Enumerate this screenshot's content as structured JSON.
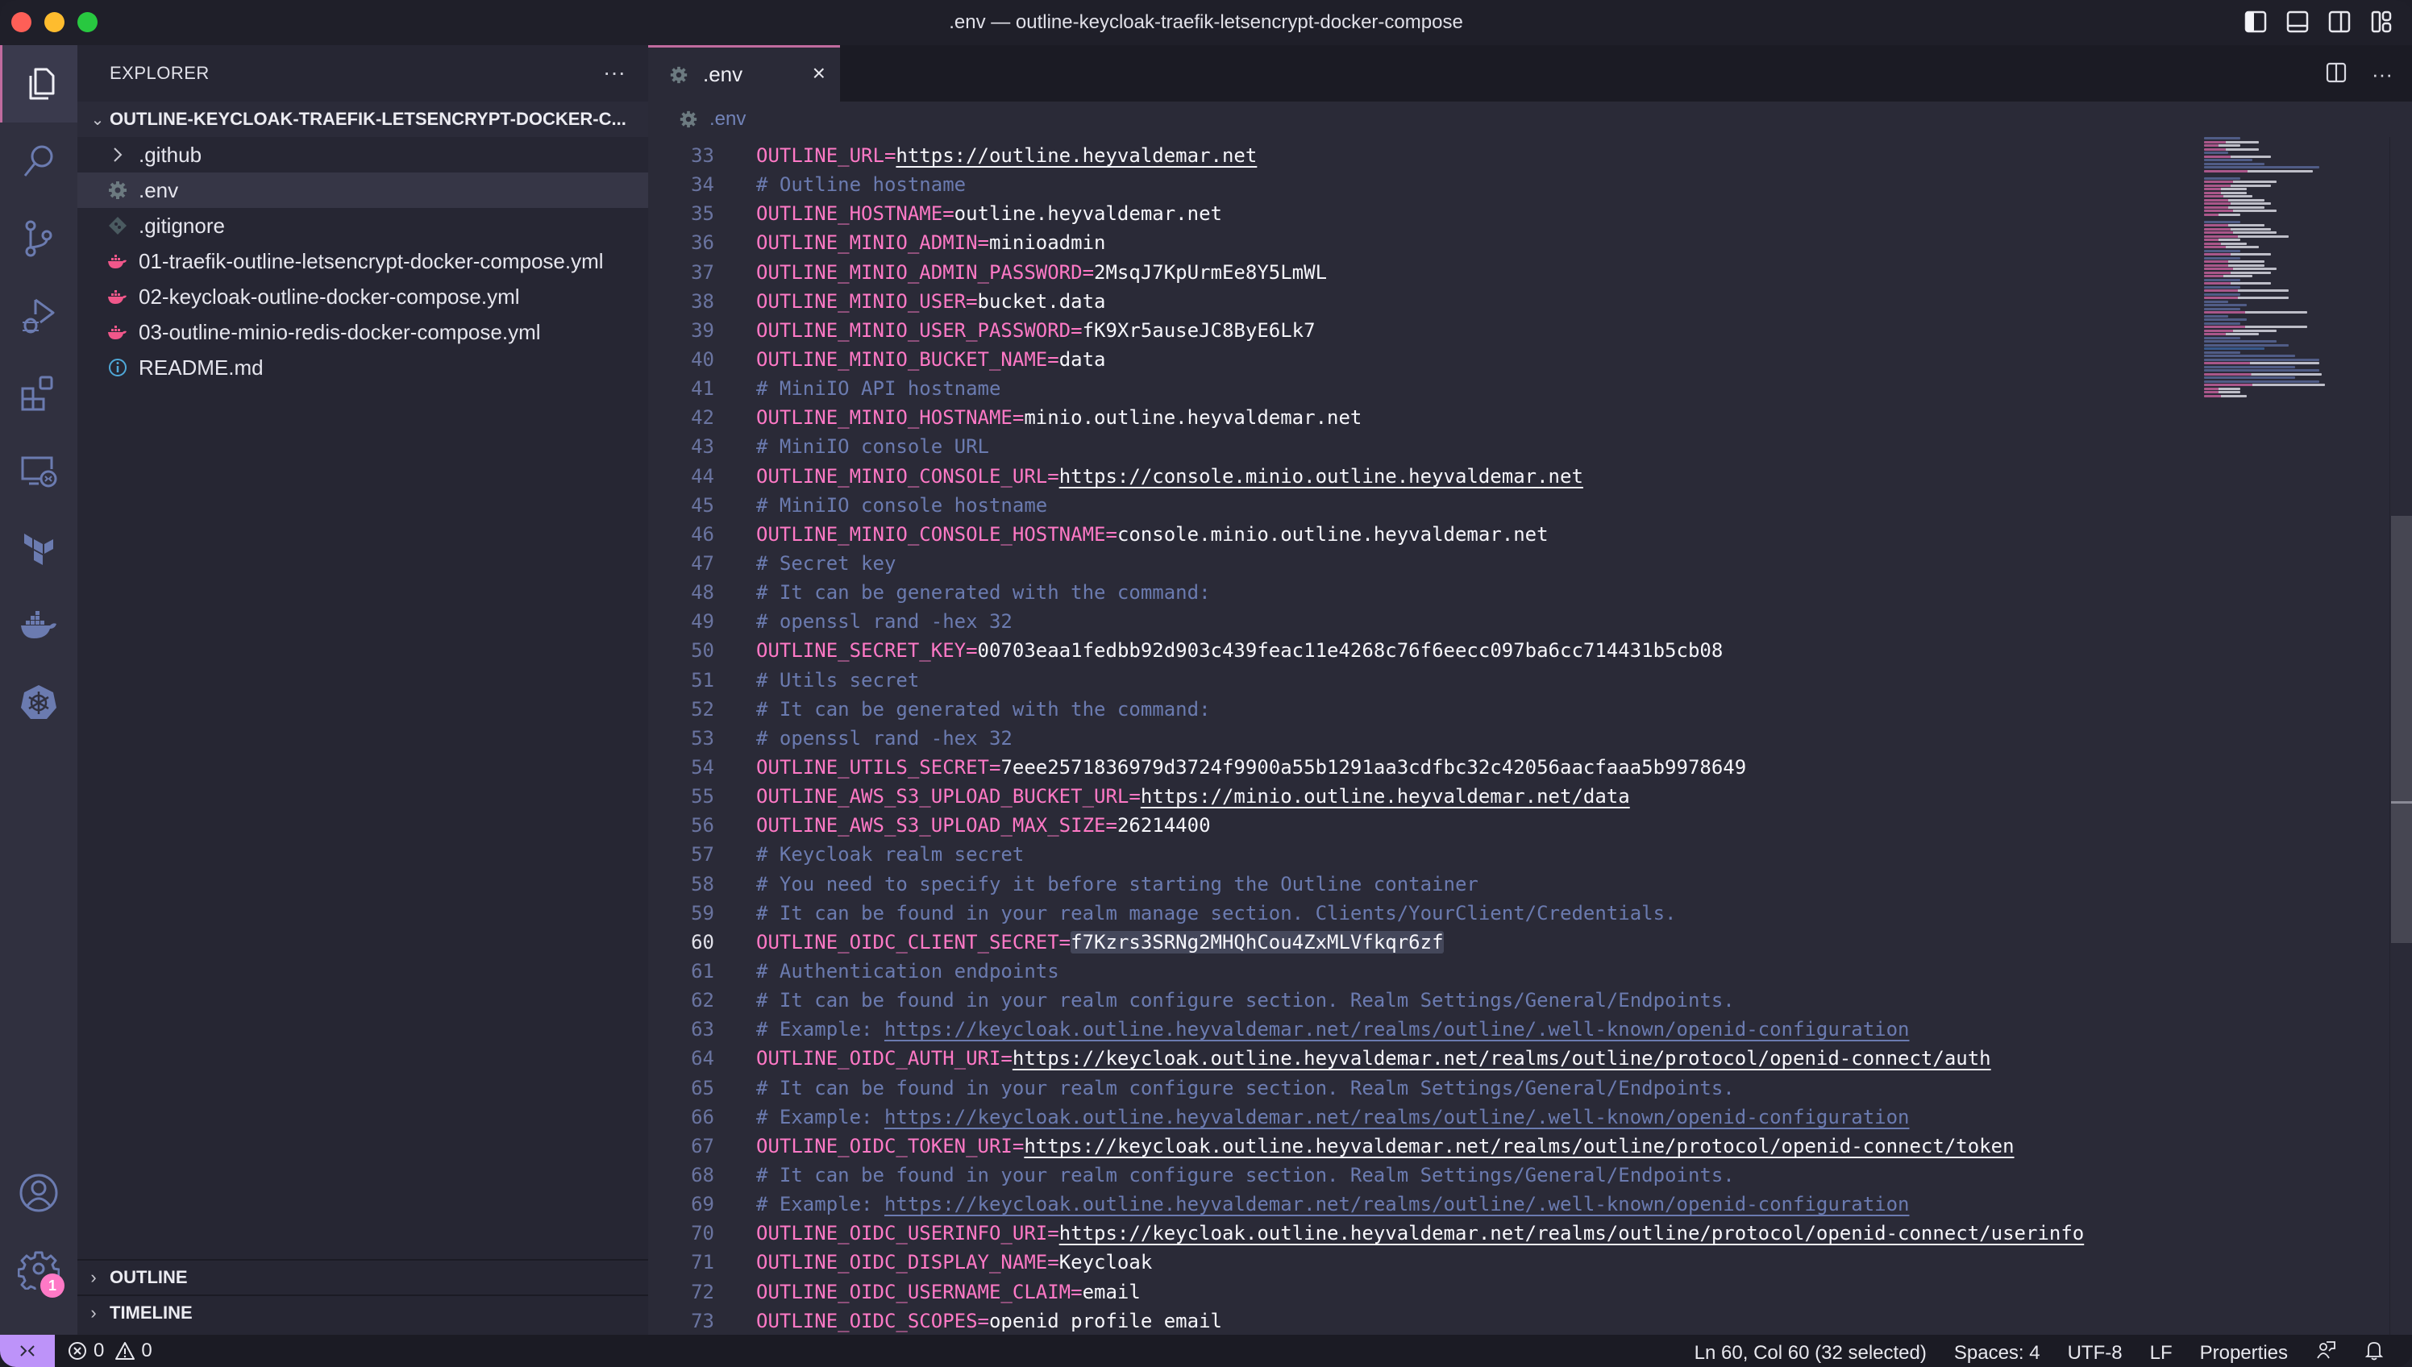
{
  "window": {
    "title": ".env — outline-keycloak-traefik-letsencrypt-docker-compose"
  },
  "activity_bar": {
    "items": [
      {
        "name": "explorer",
        "icon": "files-icon",
        "active": true
      },
      {
        "name": "search",
        "icon": "search-icon"
      },
      {
        "name": "source-control",
        "icon": "source-control-icon"
      },
      {
        "name": "run-debug",
        "icon": "run-debug-icon"
      },
      {
        "name": "extensions",
        "icon": "extensions-icon"
      },
      {
        "name": "remote-explorer",
        "icon": "remote-explorer-icon"
      },
      {
        "name": "terraform",
        "icon": "terraform-icon"
      },
      {
        "name": "docker",
        "icon": "docker-icon"
      },
      {
        "name": "kubernetes",
        "icon": "kubernetes-icon"
      }
    ],
    "account_icon": "account-icon",
    "settings_icon": "settings-gear-icon",
    "settings_badge": "1"
  },
  "sidebar": {
    "title": "EXPLORER",
    "more_label": "···",
    "root_folder": "OUTLINE-KEYCLOAK-TRAEFIK-LETSENCRYPT-DOCKER-C...",
    "items": [
      {
        "label": ".github",
        "type": "folder",
        "icon": "chevron-right-icon"
      },
      {
        "label": ".env",
        "type": "file",
        "icon": "gear-icon",
        "selected": true
      },
      {
        "label": ".gitignore",
        "type": "file",
        "icon": "git-icon"
      },
      {
        "label": "01-traefik-outline-letsencrypt-docker-compose.yml",
        "type": "file",
        "icon": "docker-icon"
      },
      {
        "label": "02-keycloak-outline-docker-compose.yml",
        "type": "file",
        "icon": "docker-icon"
      },
      {
        "label": "03-outline-minio-redis-docker-compose.yml",
        "type": "file",
        "icon": "docker-icon"
      },
      {
        "label": "README.md",
        "type": "file",
        "icon": "info-icon"
      }
    ],
    "sections": [
      {
        "label": "OUTLINE"
      },
      {
        "label": "TIMELINE"
      }
    ]
  },
  "editor": {
    "tab": {
      "label": ".env",
      "icon": "gear-icon",
      "close": "×"
    },
    "breadcrumb": ".env",
    "current_line": 60,
    "lines": [
      {
        "n": 33,
        "key": "OUTLINE_URL=",
        "value": "https://outline.heyvaldemar.net",
        "link": true
      },
      {
        "n": 34,
        "comment": "# Outline hostname"
      },
      {
        "n": 35,
        "key": "OUTLINE_HOSTNAME=",
        "value": "outline.heyvaldemar.net"
      },
      {
        "n": 36,
        "key": "OUTLINE_MINIO_ADMIN=",
        "value": "minioadmin"
      },
      {
        "n": 37,
        "key": "OUTLINE_MINIO_ADMIN_PASSWORD=",
        "value": "2MsqJ7KpUrmEe8Y5LmWL"
      },
      {
        "n": 38,
        "key": "OUTLINE_MINIO_USER=",
        "value": "bucket.data"
      },
      {
        "n": 39,
        "key": "OUTLINE_MINIO_USER_PASSWORD=",
        "value": "fK9Xr5auseJC8ByE6Lk7"
      },
      {
        "n": 40,
        "key": "OUTLINE_MINIO_BUCKET_NAME=",
        "value": "data"
      },
      {
        "n": 41,
        "comment": "# MiniIO API hostname"
      },
      {
        "n": 42,
        "key": "OUTLINE_MINIO_HOSTNAME=",
        "value": "minio.outline.heyvaldemar.net"
      },
      {
        "n": 43,
        "comment": "# MiniIO console URL"
      },
      {
        "n": 44,
        "key": "OUTLINE_MINIO_CONSOLE_URL=",
        "value": "https://console.minio.outline.heyvaldemar.net",
        "link": true
      },
      {
        "n": 45,
        "comment": "# MiniIO console hostname"
      },
      {
        "n": 46,
        "key": "OUTLINE_MINIO_CONSOLE_HOSTNAME=",
        "value": "console.minio.outline.heyvaldemar.net"
      },
      {
        "n": 47,
        "comment": "# Secret key"
      },
      {
        "n": 48,
        "comment": "# It can be generated with the command:"
      },
      {
        "n": 49,
        "comment": "# openssl rand -hex 32"
      },
      {
        "n": 50,
        "key": "OUTLINE_SECRET_KEY=",
        "value": "00703eaa1fedbb92d903c439feac11e4268c76f6eecc097ba6cc714431b5cb08"
      },
      {
        "n": 51,
        "comment": "# Utils secret"
      },
      {
        "n": 52,
        "comment": "# It can be generated with the command:"
      },
      {
        "n": 53,
        "comment": "# openssl rand -hex 32"
      },
      {
        "n": 54,
        "key": "OUTLINE_UTILS_SECRET=",
        "value": "7eee2571836979d3724f9900a55b1291aa3cdfbc32c42056aacfaaa5b9978649"
      },
      {
        "n": 55,
        "key": "OUTLINE_AWS_S3_UPLOAD_BUCKET_URL=",
        "value": "https://minio.outline.heyvaldemar.net/data",
        "link": true
      },
      {
        "n": 56,
        "key": "OUTLINE_AWS_S3_UPLOAD_MAX_SIZE=",
        "value": "26214400"
      },
      {
        "n": 57,
        "comment": "# Keycloak realm secret"
      },
      {
        "n": 58,
        "comment": "# You need to specify it before starting the Outline container"
      },
      {
        "n": 59,
        "comment": "# It can be found in your realm manage section. Clients/YourClient/Credentials."
      },
      {
        "n": 60,
        "key": "OUTLINE_OIDC_CLIENT_SECRET=",
        "value": "f7Kzrs3SRNg2MHQhCou4ZxMLVfkqr6zf",
        "selected": true
      },
      {
        "n": 61,
        "comment": "# Authentication endpoints"
      },
      {
        "n": 62,
        "comment": "# It can be found in your realm configure section. Realm Settings/General/Endpoints."
      },
      {
        "n": 63,
        "comment": "# Example: ",
        "comment_link": "https://keycloak.outline.heyvaldemar.net/realms/outline/.well-known/openid-configuration"
      },
      {
        "n": 64,
        "key": "OUTLINE_OIDC_AUTH_URI=",
        "value": "https://keycloak.outline.heyvaldemar.net/realms/outline/protocol/openid-connect/auth",
        "link": true
      },
      {
        "n": 65,
        "comment": "# It can be found in your realm configure section. Realm Settings/General/Endpoints."
      },
      {
        "n": 66,
        "comment": "# Example: ",
        "comment_link": "https://keycloak.outline.heyvaldemar.net/realms/outline/.well-known/openid-configuration"
      },
      {
        "n": 67,
        "key": "OUTLINE_OIDC_TOKEN_URI=",
        "value": "https://keycloak.outline.heyvaldemar.net/realms/outline/protocol/openid-connect/token",
        "link": true
      },
      {
        "n": 68,
        "comment": "# It can be found in your realm configure section. Realm Settings/General/Endpoints."
      },
      {
        "n": 69,
        "comment": "# Example: ",
        "comment_link": "https://keycloak.outline.heyvaldemar.net/realms/outline/.well-known/openid-configuration"
      },
      {
        "n": 70,
        "key": "OUTLINE_OIDC_USERINFO_URI=",
        "value": "https://keycloak.outline.heyvaldemar.net/realms/outline/protocol/openid-connect/userinfo",
        "link": true
      },
      {
        "n": 71,
        "key": "OUTLINE_OIDC_DISPLAY_NAME=",
        "value": "Keycloak"
      },
      {
        "n": 72,
        "key": "OUTLINE_OIDC_USERNAME_CLAIM=",
        "value": "email"
      },
      {
        "n": 73,
        "key": "OUTLINE_OIDC_SCOPES=",
        "value": "openid profile email"
      }
    ]
  },
  "statusbar": {
    "errors": "0",
    "warnings": "0",
    "cursor": "Ln 60, Col 60 (32 selected)",
    "indent": "Spaces: 4",
    "encoding": "UTF-8",
    "eol": "LF",
    "language": "Properties"
  },
  "colors": {
    "accent": "#c06b9e",
    "key": "#ff79c6",
    "comment": "#6b7bb0",
    "remote": "#bd93f9",
    "badge": "#ff79c6"
  }
}
